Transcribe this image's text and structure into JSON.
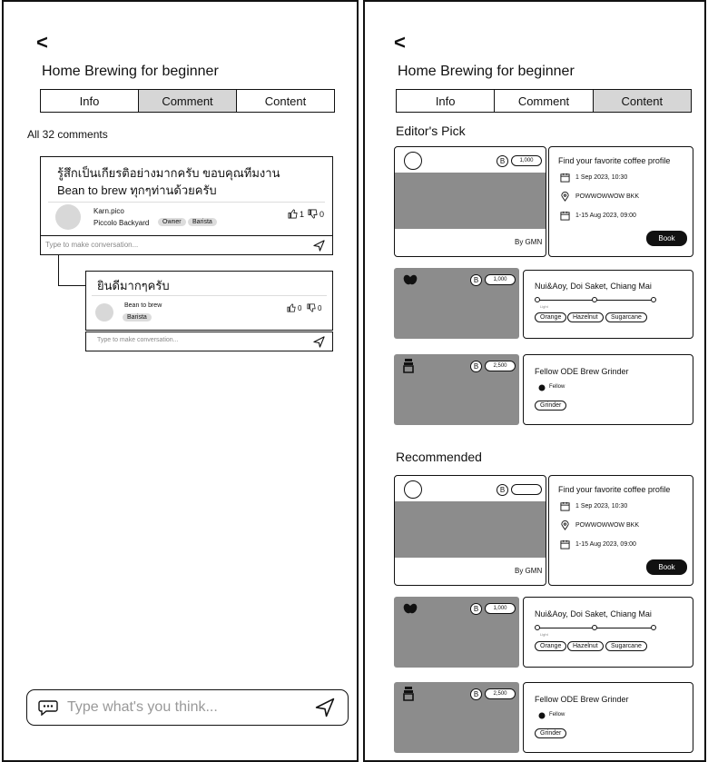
{
  "left": {
    "back": "<",
    "title": "Home Brewing for beginner",
    "tabs": [
      "Info",
      "Comment",
      "Content"
    ],
    "count": "All 32 comments",
    "comment": {
      "text_line1": "รู้สึกเป็นเกียรติอย่างมากครับ ขอบคุณทีมงาน",
      "text_line2": "Bean to brew ทุกๆท่านด้วยครับ",
      "user": "Karn.pico",
      "org": "Piccolo Backyard",
      "tags": [
        "Owner",
        "Barista"
      ],
      "likes": "1",
      "dislikes": "0",
      "reply_placeholder": "Type to make conversation..."
    },
    "reply": {
      "text": "ยินดีมากๆครับ",
      "user": "Bean to brew",
      "tag": "Barista",
      "likes": "0",
      "dislikes": "0",
      "reply_placeholder": "Type to make conversation..."
    },
    "input_placeholder": "Type what's you think..."
  },
  "right": {
    "back": "<",
    "title": "Home Brewing for beginner",
    "tabs": [
      "Info",
      "Comment",
      "Content"
    ],
    "editors_pick": "Editor's Pick",
    "recommended": "Recommended",
    "event": {
      "price": "1,000",
      "by": "By GMN",
      "title": "Find your favorite coffee profile",
      "date": "1 Sep 2023, 10:30",
      "location": "POWWOWWOW BKK",
      "period": "1-15 Aug 2023, 09:00",
      "button": "Book"
    },
    "bean": {
      "price": "1,000",
      "title": "Nui&Aoy, Doi Saket, Chiang Mai",
      "scale_label": "Light",
      "notes": [
        "Orange",
        "Hazelnut",
        "Sugarcane"
      ]
    },
    "grinder": {
      "price": "2,500",
      "title": "Fellow ODE Brew Grinder",
      "brand": "Fellow",
      "tag": "Grinder"
    },
    "baht_symbol": "B"
  }
}
